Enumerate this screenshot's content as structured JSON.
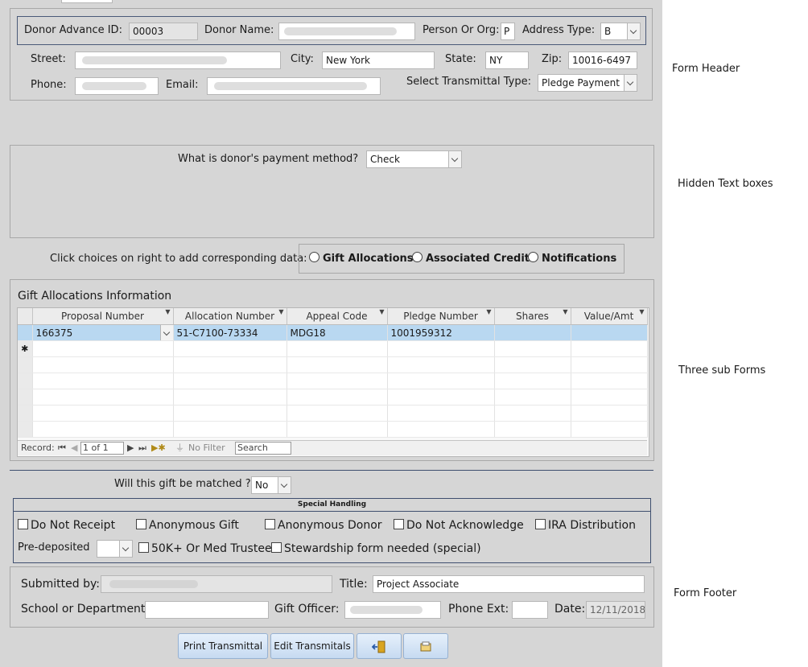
{
  "colors": {
    "form_bg": "#d6d6d6",
    "button_bg": "#c6daf1",
    "selected_row": "#b9d8f1"
  },
  "header": {
    "donor_advance_id_label": "Donor Advance ID:",
    "donor_advance_id_value": "00003",
    "donor_name_label": "Donor Name:",
    "person_or_org_label": "Person Or Org:",
    "person_or_org_value": "P",
    "address_type_label": "Address Type:",
    "address_type_value": "B",
    "street_label": "Street:",
    "city_label": "City:",
    "city_value": "New York",
    "state_label": "State:",
    "state_value": "NY",
    "zip_label": "Zip:",
    "zip_value": "10016-6497",
    "phone_label": "Phone:",
    "email_label": "Email:",
    "transmittal_type_label": "Select Transmittal Type:",
    "transmittal_type_value": "Pledge Payment"
  },
  "payment": {
    "question": "What is donor's payment method?",
    "value": "Check"
  },
  "choices": {
    "prompt": "Click choices on right to add corresponding data:",
    "options": [
      "Gift Allocations",
      "Associated Credits",
      "Notifications"
    ]
  },
  "gift_allocations": {
    "title": "Gift Allocations Information",
    "columns": [
      "Proposal Number",
      "Allocation Number",
      "Appeal Code",
      "Pledge Number",
      "Shares",
      "Value/Amt"
    ],
    "rows": [
      [
        "166375",
        "51-C7100-73334",
        "MDG18",
        "1001959312",
        "",
        ""
      ]
    ],
    "new_row_marker": "✱",
    "nav": {
      "record_label": "Record:",
      "position": "1 of 1",
      "filter": "No Filter",
      "search": "Search"
    }
  },
  "matching": {
    "question": "Will this gift be matched ?",
    "value": "No"
  },
  "special_handling": {
    "title": "Special Handling",
    "checkboxes": [
      "Do Not Receipt",
      "Anonymous Gift",
      "Anonymous Donor",
      "Do Not Acknowledge",
      "IRA Distribution"
    ],
    "pre_deposited_label": "Pre-deposited",
    "checkboxes_row2": [
      "50K+ Or Med Trustee",
      "Stewardship form needed (special)"
    ]
  },
  "footer": {
    "submitted_by_label": "Submitted by:",
    "title_label": "Title:",
    "title_value": "Project Associate",
    "school_label": "School or Department:",
    "gift_officer_label": "Gift Officer:",
    "phone_ext_label": "Phone Ext:",
    "date_label": "Date:",
    "date_value": "12/11/2018"
  },
  "buttons": {
    "print": "Print Transmittal",
    "edit": "Edit Transmitals",
    "exit_icon": "exit-door-icon",
    "folder_icon": "folder-icon"
  },
  "annotations": [
    "Form Header",
    "Hidden Text boxes",
    "Three sub Forms",
    "Form Footer"
  ]
}
